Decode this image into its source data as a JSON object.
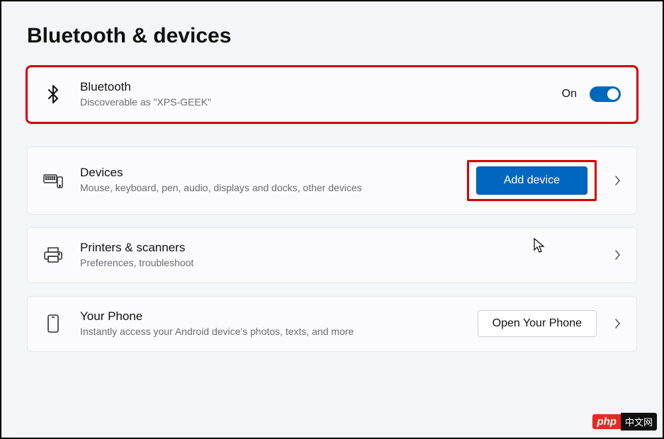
{
  "page": {
    "title": "Bluetooth & devices"
  },
  "bluetooth": {
    "title": "Bluetooth",
    "subtitle": "Discoverable as \"XPS-GEEK\"",
    "status": "On"
  },
  "devices": {
    "title": "Devices",
    "subtitle": "Mouse, keyboard, pen, audio, displays and docks, other devices",
    "button": "Add device"
  },
  "printers": {
    "title": "Printers & scanners",
    "subtitle": "Preferences, troubleshoot"
  },
  "phone": {
    "title": "Your Phone",
    "subtitle": "Instantly access your Android device's photos, texts, and more",
    "button": "Open Your Phone"
  },
  "watermark": {
    "php": "php",
    "rest": "中文网"
  }
}
